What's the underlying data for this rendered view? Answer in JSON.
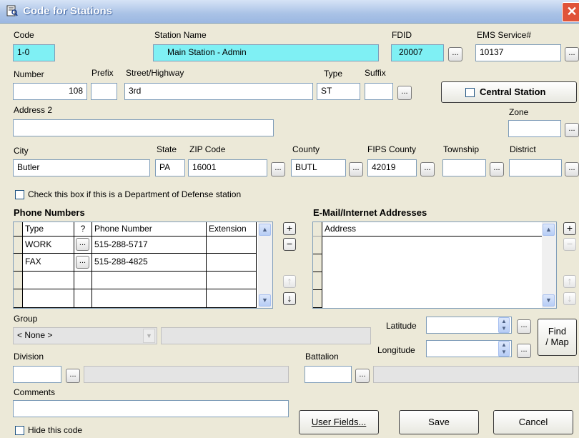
{
  "window": {
    "title": "Code for Stations",
    "close_glyph": "✕"
  },
  "labels": {
    "code": "Code",
    "station_name": "Station Name",
    "fdid": "FDID",
    "ems_service": "EMS Service#",
    "number": "Number",
    "prefix": "Prefix",
    "street": "Street/Highway",
    "type": "Type",
    "suffix": "Suffix",
    "address2": "Address 2",
    "zone": "Zone",
    "city": "City",
    "state": "State",
    "zip": "ZIP Code",
    "county": "County",
    "fips_county": "FIPS County",
    "township": "Township",
    "district": "District",
    "group": "Group",
    "division": "Division",
    "battalion": "Battalion",
    "comments": "Comments",
    "latitude": "Latitude",
    "longitude": "Longitude"
  },
  "values": {
    "code": "1-0",
    "station_name": "Main Station - Admin",
    "fdid": "20007",
    "ems_service": "10137",
    "number": "108",
    "prefix": "",
    "street": "3rd",
    "type": "ST",
    "suffix": "",
    "address2": "",
    "zone": "",
    "city": "Butler",
    "state": "PA",
    "zip": "16001",
    "county": "BUTL",
    "fips_county": "42019",
    "township": "",
    "district": "",
    "group": "< None >",
    "group_desc": "",
    "division": "",
    "division_desc": "",
    "battalion": "",
    "battalion_desc": "",
    "comments": "",
    "latitude": "",
    "longitude": ""
  },
  "dots_label": "...",
  "central_station": {
    "label": "Central Station",
    "checked": false
  },
  "dod_checkbox": {
    "label": "Check this box if this is a Department of Defense station",
    "checked": false
  },
  "hide_code": {
    "label": "Hide this code",
    "checked": false
  },
  "phones": {
    "title": "Phone Numbers",
    "columns": [
      "Type",
      "?",
      "Phone Number",
      "Extension"
    ],
    "rows": [
      {
        "type": "WORK",
        "phone": "515-288-5717",
        "extension": ""
      },
      {
        "type": "FAX",
        "phone": "515-288-4825",
        "extension": ""
      }
    ]
  },
  "email": {
    "title": "E-Mail/Internet Addresses",
    "columns": [
      "Address"
    ]
  },
  "grid_buttons": {
    "add": "+",
    "remove": "−",
    "up": "↑",
    "down": "↓"
  },
  "buttons": {
    "find_map_line1": "Find",
    "find_map_line2": "/ Map",
    "user_fields": "User Fields...",
    "save": "Save",
    "cancel": "Cancel"
  },
  "colors": {
    "highlight": "#7ff0f4",
    "title_start": "#d6e3f6",
    "close": "#e0543a"
  }
}
